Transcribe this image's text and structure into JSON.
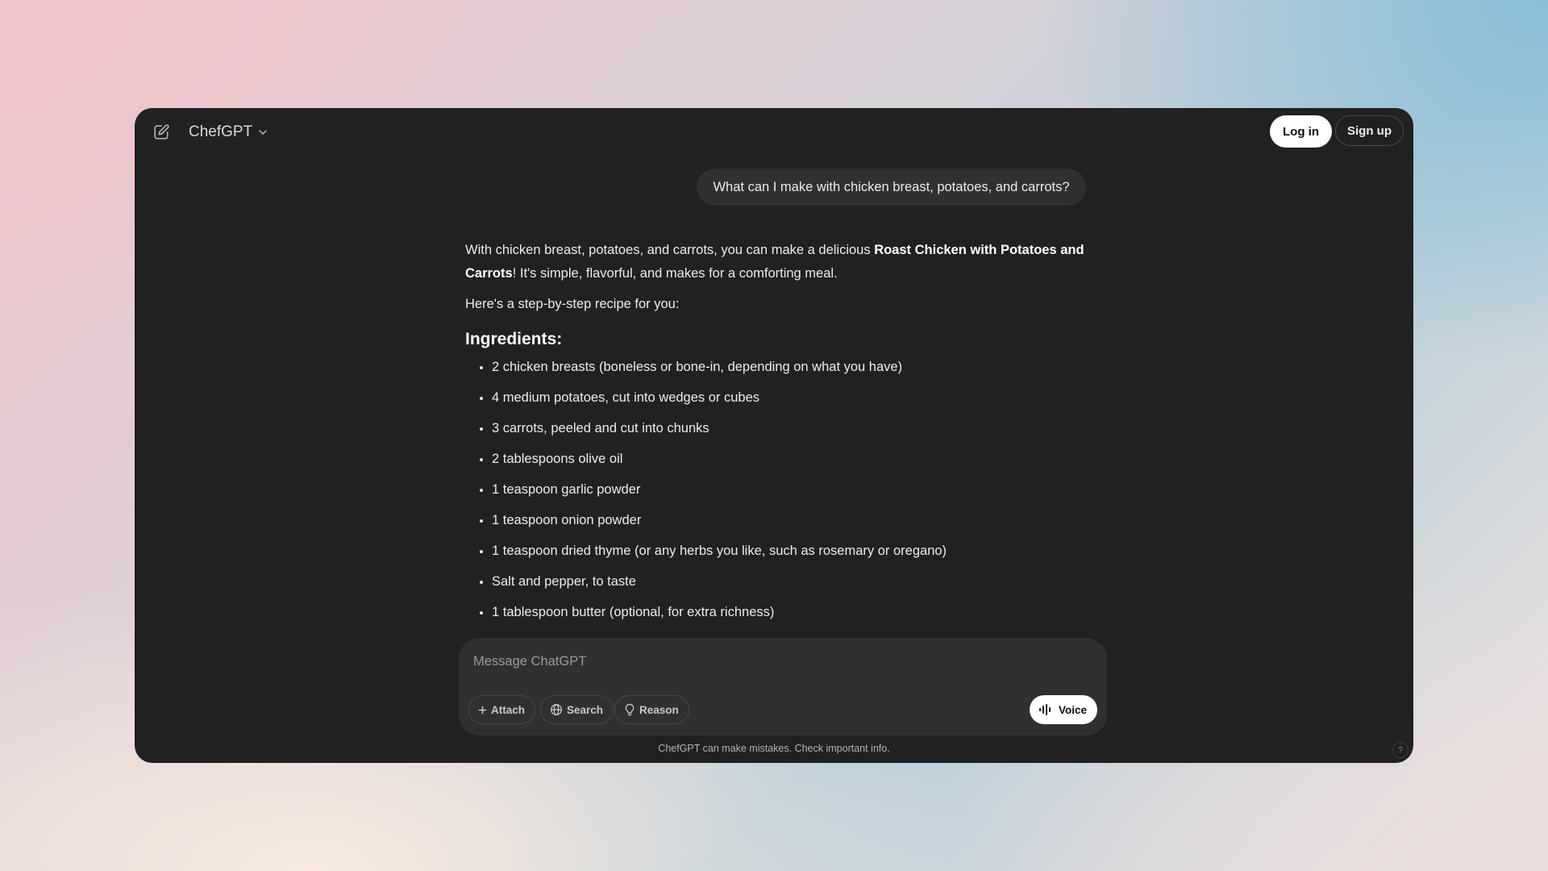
{
  "header": {
    "model_name": "ChefGPT",
    "login_label": "Log in",
    "signup_label": "Sign up",
    "icons": [
      "edit-icon",
      "chevron-down-icon"
    ]
  },
  "conversation": {
    "user_message": "What can I make with chicken breast, potatoes, and carrots?",
    "assistant": {
      "intro_prefix": "With chicken breast, potatoes, and carrots, you can make a delicious ",
      "intro_bold": "Roast Chicken with Potatoes and Carrots",
      "intro_suffix": "! It's simple, flavorful, and makes for a comforting meal.",
      "step_intro": "Here's a step-by-step recipe for you:",
      "ingredients_heading": "Ingredients",
      "ingredients_heading_suffix": ":",
      "ingredients": [
        "2 chicken breasts (boneless or bone-in, depending on what you have)",
        "4 medium potatoes, cut into wedges or cubes",
        "3 carrots, peeled and cut into chunks",
        "2 tablespoons olive oil",
        "1 teaspoon garlic powder",
        "1 teaspoon onion powder",
        "1 teaspoon dried thyme (or any herbs you like, such as rosemary or oregano)",
        "Salt and pepper, to taste",
        "1 tablespoon butter (optional, for extra richness)"
      ]
    }
  },
  "composer": {
    "placeholder": "Message ChatGPT",
    "attach_label": "Attach",
    "search_label": "Search",
    "reason_label": "Reason",
    "voice_label": "Voice",
    "icons": [
      "plus-icon",
      "globe-icon",
      "lightbulb-icon",
      "voice-waveform-icon"
    ]
  },
  "footer": {
    "disclaimer": "ChefGPT can make mistakes. Check important info.",
    "help_label": "?"
  },
  "colors": {
    "window_bg": "#212121",
    "bubble_bg": "#303030",
    "text": "#ececec"
  }
}
